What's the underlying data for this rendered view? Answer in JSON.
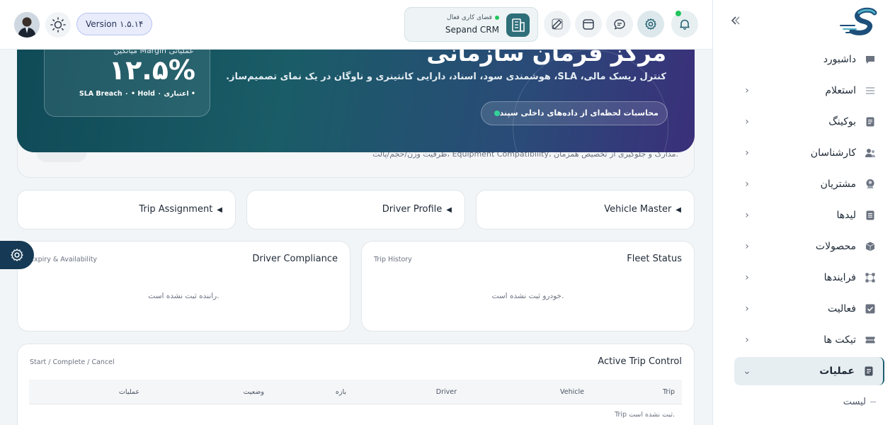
{
  "colors": {
    "brand": "#1d5f6e",
    "hero_start": "#0f4a57",
    "hero_end": "#3a2f7a",
    "accent_green": "#22c55e",
    "float_button": "#163a55"
  },
  "topbar": {
    "version_label": "Version ۱.۵.۱۴",
    "workspace": {
      "status_label": "فضای کاری فعال",
      "name": "Sepand CRM"
    },
    "icons": [
      "user-avatar",
      "sun-icon",
      "building-icon",
      "edit-icon",
      "calendar-icon",
      "chat-icon",
      "gear-icon",
      "bell-icon"
    ]
  },
  "sidebar": {
    "items": [
      {
        "label": "داشبورد",
        "icon": "chat-bubble-icon",
        "has_chevron": false
      },
      {
        "label": "استعلام",
        "icon": "menu-lines-icon",
        "has_chevron": true
      },
      {
        "label": "بوکینگ",
        "icon": "document-icon",
        "has_chevron": true
      },
      {
        "label": "کارشناسان",
        "icon": "users-icon",
        "has_chevron": true
      },
      {
        "label": "مشتریان",
        "icon": "user-icon",
        "has_chevron": true
      },
      {
        "label": "لیدها",
        "icon": "list-icon",
        "has_chevron": true
      },
      {
        "label": "محصولات",
        "icon": "box-icon",
        "has_chevron": true
      },
      {
        "label": "فرایندها",
        "icon": "workflow-icon",
        "has_chevron": true
      },
      {
        "label": "فعالیت",
        "icon": "check-square-icon",
        "has_chevron": true
      },
      {
        "label": "تیکت ها",
        "icon": "ticket-icon",
        "has_chevron": true
      },
      {
        "label": "عملیات",
        "icon": "document-icon",
        "has_chevron": true,
        "active": true,
        "expanded": true
      }
    ],
    "sub_items": [
      {
        "label": "لیست"
      }
    ]
  },
  "hero": {
    "title": "مرکز فرمان سازمانی",
    "subtitle": "کنترل ریسک مالی، SLA، هوشمندی سود، اسناد، دارایی کانتینری و ناوگان در یک نمای تصمیم‌ساز.",
    "chip_label": "محاسبات لحظه‌ای از داده‌های داخلی سپند",
    "margin_card": {
      "label": "میانگین Margin عملیاتی",
      "value": "۱۲.۵%",
      "note": "SLA Breach ۰ • Hold اعتباری ۰ •"
    },
    "back_description": "ظرفیت وزن/حجم/پالت، Equipment Compatibility، مدارک و جلوگیری از تخصیص همزمان."
  },
  "nav_cards": [
    {
      "label": "Vehicle Master"
    },
    {
      "label": "Driver Profile"
    },
    {
      "label": "Trip Assignment"
    }
  ],
  "fleet_status": {
    "title": "Fleet Status",
    "subtitle": "Trip History",
    "empty": "خودرو ثبت نشده است."
  },
  "driver_compliance": {
    "title": "Driver Compliance",
    "subtitle": "Expiry & Availability",
    "empty": "راننده ثبت نشده است."
  },
  "trip_control": {
    "title": "Active Trip Control",
    "subtitle": "Start / Complete / Cancel",
    "columns": [
      "Trip",
      "Vehicle",
      "Driver",
      "بازه",
      "وضعیت",
      "عملیات"
    ],
    "empty": "Trip ثبت نشده است."
  }
}
